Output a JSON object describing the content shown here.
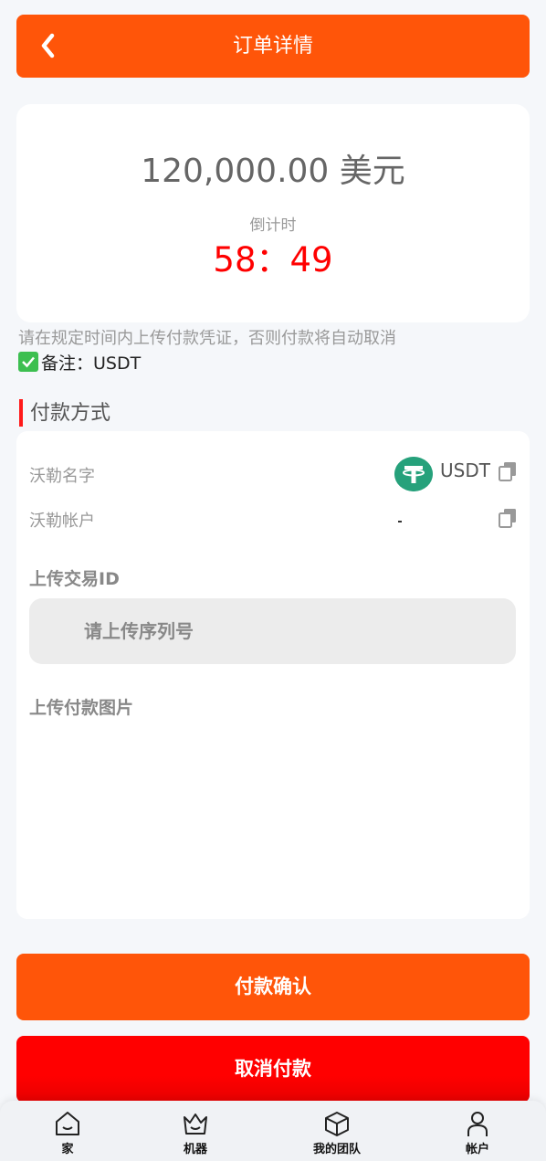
{
  "header": {
    "title": "订单详情"
  },
  "order": {
    "amount": "120,000.00 美元",
    "countdown_label": "倒计时",
    "countdown": "58：49"
  },
  "notice": "请在规定时间内上传付款凭证，否则付款将自动取消",
  "remark": "备注：USDT",
  "payment": {
    "section_title": "付款方式",
    "name_label": "沃勒名字",
    "name_value": "USDT",
    "account_label": "沃勒帐户",
    "txid_label": "上传交易ID",
    "txid_placeholder": "请上传序列号",
    "image_label": "上传付款图片"
  },
  "buttons": {
    "confirm": "付款确认",
    "cancel": "取消付款"
  },
  "tabbar": [
    {
      "label": "家",
      "icon": "home-icon"
    },
    {
      "label": "机器",
      "icon": "crown-icon"
    },
    {
      "label": "我的团队",
      "icon": "cube-icon"
    },
    {
      "label": "帐户",
      "icon": "user-icon"
    }
  ],
  "colors": {
    "accent": "#ff5509",
    "danger": "#ff0000",
    "usdt": "#26a17b"
  }
}
